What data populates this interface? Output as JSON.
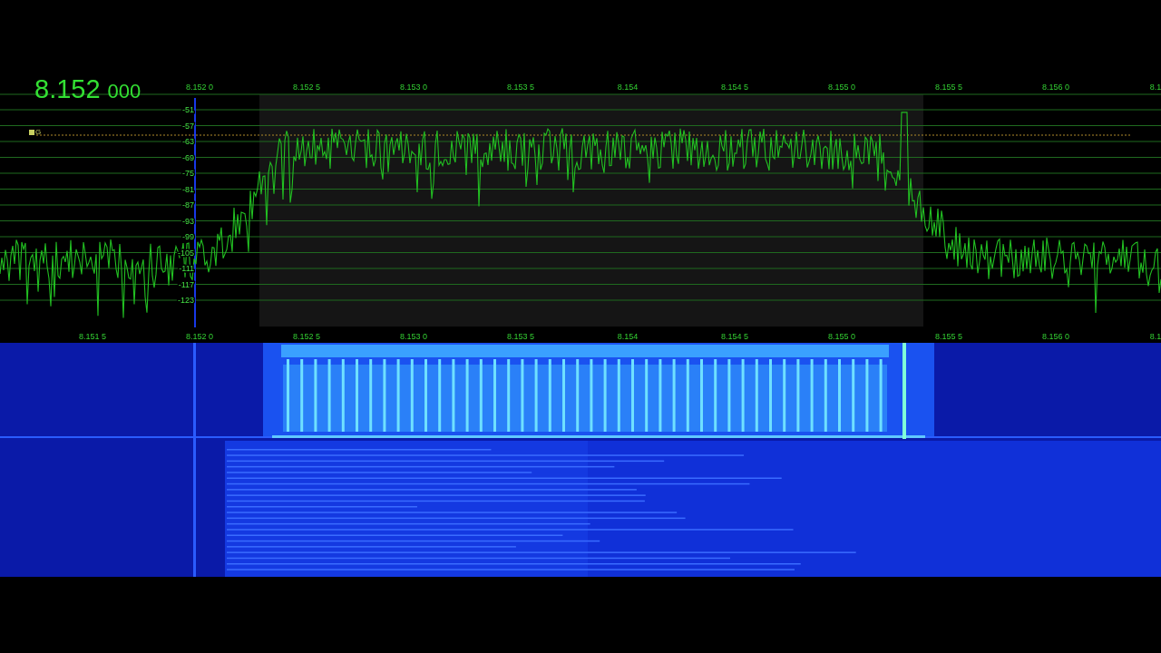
{
  "frequency": {
    "main": "8.152",
    "sub": "000"
  },
  "spectrum": {
    "top_axis": [
      "8.152 0",
      "8.152 5",
      "8.153 0",
      "8.153 5",
      "8.154",
      "8.154 5",
      "8.155 0",
      "8.155 5",
      "8.156 0",
      "8.1"
    ],
    "db_axis": [
      "-51",
      "-57",
      "-63",
      "-69",
      "-75",
      "-81",
      "-87",
      "-93",
      "-99",
      "-105",
      "-111",
      "-117",
      "-123"
    ],
    "bottom_axis": [
      "8.151 5",
      "8.152 0",
      "8.152 5",
      "8.153 0",
      "8.153 5",
      "8.154",
      "8.154 5",
      "8.155 0",
      "8.155 5",
      "8.156 0",
      "8.1"
    ],
    "marker_label": "G"
  }
}
